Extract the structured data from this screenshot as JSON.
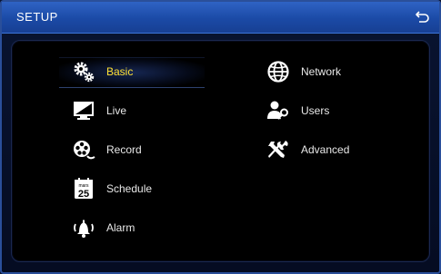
{
  "window": {
    "title": "SETUP",
    "back_icon": "return-icon"
  },
  "menu": {
    "left": [
      {
        "label": "Basic",
        "icon": "gears-icon",
        "active": true
      },
      {
        "label": "Live",
        "icon": "monitor-icon",
        "active": false
      },
      {
        "label": "Record",
        "icon": "film-reel-icon",
        "active": false
      },
      {
        "label": "Schedule",
        "icon": "calendar-icon",
        "active": false,
        "icon_text_month": "mars",
        "icon_text_day": "25"
      },
      {
        "label": "Alarm",
        "icon": "bell-icon",
        "active": false
      }
    ],
    "right": [
      {
        "label": "Network",
        "icon": "globe-icon",
        "active": false
      },
      {
        "label": "Users",
        "icon": "users-icon",
        "active": false
      },
      {
        "label": "Advanced",
        "icon": "tools-icon",
        "active": false
      }
    ]
  },
  "colors": {
    "active_label": "#ffe033",
    "titlebar": "#2356b8",
    "background": "#000000"
  }
}
